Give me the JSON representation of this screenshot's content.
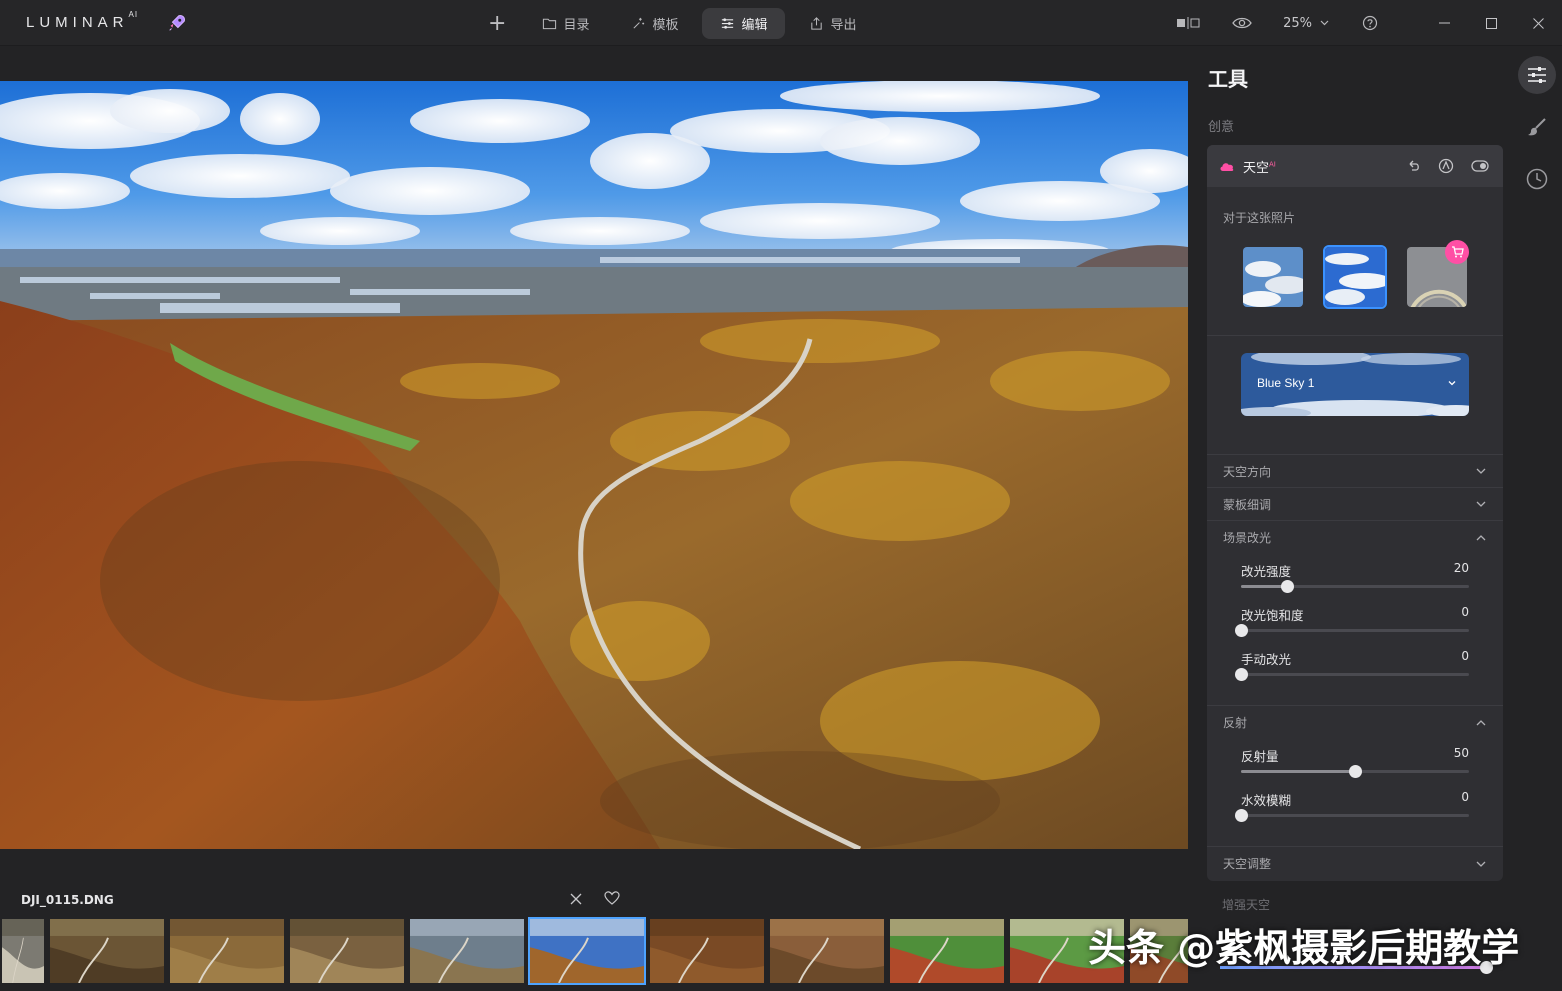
{
  "app": {
    "logo_text": "LUMINAR",
    "logo_sup": "AI"
  },
  "nav": {
    "add_label": "+",
    "catalog": "目录",
    "templates": "模板",
    "edit": "编辑",
    "export": "导出"
  },
  "topright": {
    "zoom": "25%"
  },
  "filmstrip": {
    "filename": "DJI_0115.DNG",
    "thumb_count": 11,
    "active_index": 5
  },
  "panel": {
    "title": "工具",
    "section": "创意",
    "tool_name": "天空",
    "tool_sup": "AI",
    "for_this_photo": "对于这张照片",
    "sky_name": "Blue Sky 1",
    "rows": {
      "sky_orientation": "天空方向",
      "mask_refine": "蒙板细调",
      "relight": "场景改光",
      "reflection": "反射",
      "sky_adjust": "天空调整",
      "enhance_hidden": "增强天空"
    },
    "sliders": {
      "relight_strength": {
        "label": "改光强度",
        "value": "20",
        "fraction": 0.2
      },
      "relight_saturation": {
        "label": "改光饱和度",
        "value": "0",
        "fraction": 0
      },
      "manual_relight": {
        "label": "手动改光",
        "value": "0",
        "fraction": 0
      },
      "reflection_amount": {
        "label": "反射量",
        "value": "50",
        "fraction": 0.5
      },
      "water_blur": {
        "label": "水效模糊",
        "value": "0",
        "fraction": 0
      }
    }
  },
  "watermark": "头条 @紫枫摄影后期教学",
  "colors": {
    "accent": "#3b92ff",
    "pink": "#ff4fa5"
  }
}
